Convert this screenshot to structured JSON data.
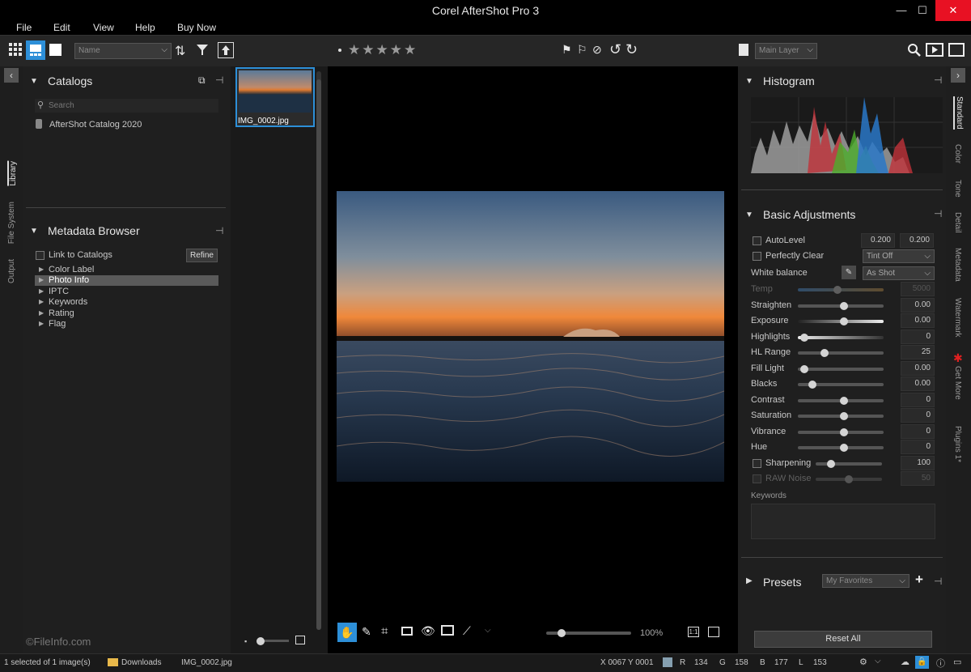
{
  "window": {
    "title": "Corel AfterShot Pro 3",
    "min": "—",
    "max": "☐",
    "close": "✕"
  },
  "menu": [
    "File",
    "Edit",
    "View",
    "Help",
    "Buy Now"
  ],
  "toolbar": {
    "sort_dropdown": "Name",
    "layer_dropdown": "Main Layer",
    "color_labels": [
      "#8c8c8c",
      "#ff0000",
      "#ffff00",
      "#00ff00",
      "#0000ff",
      "#ff00ff"
    ]
  },
  "left_tabs": [
    "Library",
    "File System",
    "Output"
  ],
  "catalogs": {
    "title": "Catalogs",
    "search_placeholder": "Search",
    "items": [
      "AfterShot Catalog 2020"
    ]
  },
  "metadata": {
    "title": "Metadata Browser",
    "link_label": "Link to Catalogs",
    "refine": "Refine",
    "items": [
      "Color Label",
      "Photo Info",
      "IPTC",
      "Keywords",
      "Rating",
      "Flag"
    ],
    "selected_index": 1
  },
  "filmstrip": {
    "thumb_label": "IMG_0002.jpg"
  },
  "viewer": {
    "zoom": "100%",
    "fit_1to1": "1:1"
  },
  "histogram": {
    "title": "Histogram"
  },
  "basic": {
    "title": "Basic Adjustments",
    "autolevel": {
      "label": "AutoLevel",
      "v1": "0.200",
      "v2": "0.200"
    },
    "perfectly_clear": {
      "label": "Perfectly Clear",
      "option": "Tint Off"
    },
    "white_balance": {
      "label": "White balance",
      "option": "As Shot"
    },
    "sliders": [
      {
        "label": "Temp",
        "value": "5000",
        "dim": true
      },
      {
        "label": "Straighten",
        "value": "0.00"
      },
      {
        "label": "Exposure",
        "value": "0.00"
      },
      {
        "label": "Highlights",
        "value": "0"
      },
      {
        "label": "HL Range",
        "value": "25"
      },
      {
        "label": "Fill Light",
        "value": "0.00"
      },
      {
        "label": "Blacks",
        "value": "0.00"
      },
      {
        "label": "Contrast",
        "value": "0"
      },
      {
        "label": "Saturation",
        "value": "0"
      },
      {
        "label": "Vibrance",
        "value": "0"
      },
      {
        "label": "Hue",
        "value": "0"
      }
    ],
    "sharpening": {
      "label": "Sharpening",
      "value": "100"
    },
    "raw_noise": {
      "label": "RAW Noise",
      "value": "50"
    },
    "keywords_label": "Keywords"
  },
  "presets": {
    "title": "Presets",
    "option": "My Favorites",
    "add": "+"
  },
  "reset_all": "Reset All",
  "right_tabs": [
    "Standard",
    "Color",
    "Tone",
    "Detail",
    "Metadata",
    "Watermark",
    "Get More",
    "Plugins 1*"
  ],
  "status": {
    "selection": "1 selected of 1 image(s)",
    "folder": "Downloads",
    "file": "IMG_0002.jpg",
    "x": "X 0067",
    "y": "Y 0001",
    "r_label": "R",
    "r": "134",
    "g_label": "G",
    "g": "158",
    "b_label": "B",
    "b": "177",
    "l_label": "L",
    "l": "153"
  },
  "watermark": "©FileInfo.com"
}
